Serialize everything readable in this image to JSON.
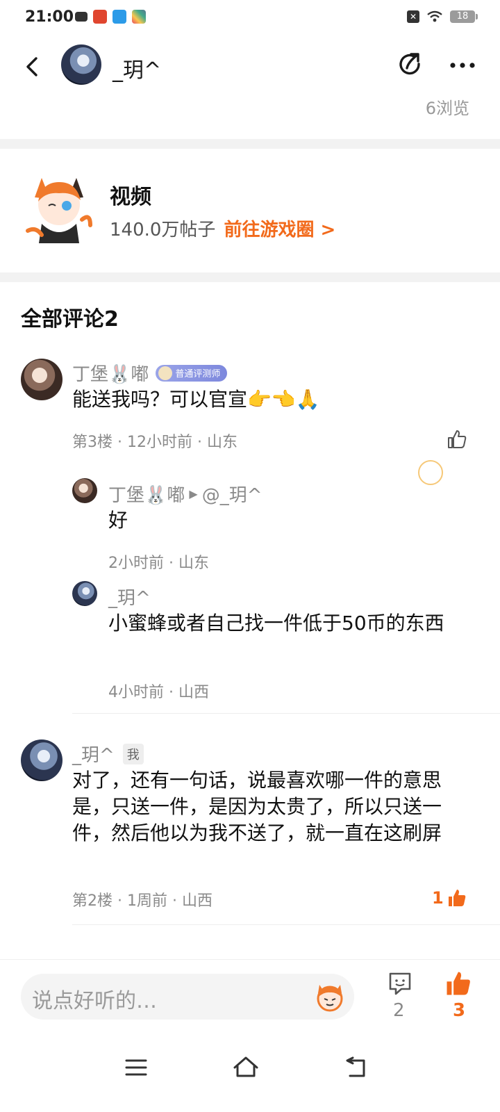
{
  "status": {
    "time": "21:00",
    "battery": "18"
  },
  "header": {
    "username": "_玥^",
    "views": "6浏览"
  },
  "circle": {
    "title": "视频",
    "posts": "140.0万帖子",
    "link": "前往游戏圈 >"
  },
  "comments": {
    "title": "全部评论2",
    "items": [
      {
        "user": "丁堡🐰嘟",
        "badge": "普通评测师",
        "text": "能送我吗？可以官宣👉👈🙏",
        "meta": "第3楼 · 12小时前 · 山东",
        "replies": [
          {
            "user": "丁堡🐰嘟",
            "reply_to": "@_玥^",
            "text": "好",
            "meta": "2小时前 · 山东"
          },
          {
            "user": "_玥^",
            "text": "小蜜蜂或者自己找一件低于50币的东西",
            "meta": "4小时前 · 山西"
          }
        ]
      },
      {
        "user": "_玥^",
        "me_tag": "我",
        "text": "对了，还有一句话，说最喜欢哪一件的意思是，只送一件，是因为太贵了，所以只送一件，然后他以为我不送了，就一直在这刷屏",
        "meta": "第2楼 · 1周前 · 山西",
        "likes": "1"
      }
    ]
  },
  "bottom": {
    "placeholder": "说点好听的…",
    "comment_count": "2",
    "like_count": "3"
  },
  "colors": {
    "accent": "#f26a1b",
    "gray_text": "#8a8a8a"
  }
}
